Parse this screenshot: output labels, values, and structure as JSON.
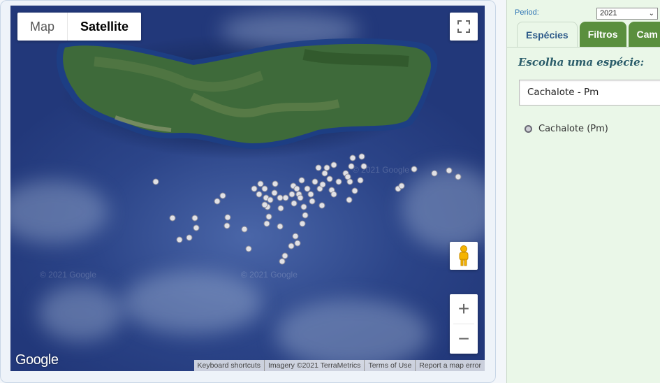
{
  "map": {
    "type_buttons": {
      "map": "Map",
      "satellite": "Satellite"
    },
    "logo": "Google",
    "watermark": "© 2021 Google",
    "attribution": {
      "shortcuts": "Keyboard shortcuts",
      "imagery": "Imagery ©2021 TerraMetrics",
      "terms": "Terms of Use",
      "report": "Report a map error"
    },
    "zoom_in": "+",
    "zoom_out": "−",
    "icons": {
      "fullscreen": "fullscreen-icon",
      "pegman": "pegman-icon"
    },
    "marker_color": "#e1e1e6"
  },
  "panel": {
    "period_label": "Period:",
    "period_value": "2021",
    "tabs": [
      {
        "label": "Espécies",
        "active": true
      },
      {
        "label": "Filtros",
        "active": false
      },
      {
        "label": "Cam",
        "active": false
      }
    ],
    "prompt": "Escolha uma espécie:",
    "species_selected": "Cachalote - Pm",
    "legend_label": "Cachalote (Pm)",
    "colors": {
      "tab_inactive": "#5a8f3e",
      "panel_bg": "#eaf7e8",
      "prompt": "#2a5c6a"
    }
  }
}
